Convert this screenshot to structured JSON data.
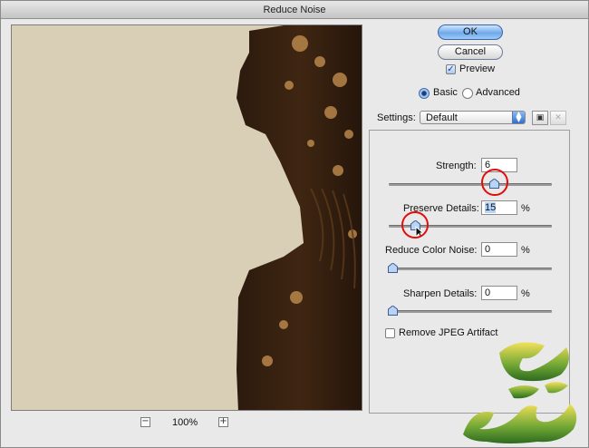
{
  "window": {
    "title": "Reduce Noise"
  },
  "preview": {
    "zoom_label": "100%",
    "zoom_out_glyph": "−",
    "zoom_in_glyph": "+"
  },
  "buttons": {
    "ok_label": "OK",
    "cancel_label": "Cancel"
  },
  "preview_checkbox": {
    "label": "Preview",
    "checked": true
  },
  "mode": {
    "basic_label": "Basic",
    "advanced_label": "Advanced",
    "selected": "Basic"
  },
  "settings": {
    "label": "Settings:",
    "value": "Default"
  },
  "sliders": {
    "strength": {
      "label": "Strength:",
      "value": "6",
      "unit": "",
      "max": 10
    },
    "preserve_details": {
      "label": "Preserve Details:",
      "value": "15",
      "unit": "%",
      "max": 100
    },
    "reduce_color_noise": {
      "label": "Reduce Color Noise:",
      "value": "0",
      "unit": "%",
      "max": 100
    },
    "sharpen_details": {
      "label": "Sharpen Details:",
      "value": "0",
      "unit": "%",
      "max": 100
    }
  },
  "jpeg_checkbox": {
    "label": "Remove JPEG Artifact",
    "checked": false
  },
  "colors": {
    "highlight_ring": "#e10d0d",
    "accent": "#2f6ed0",
    "preview_bg": "#d9cfb7"
  }
}
